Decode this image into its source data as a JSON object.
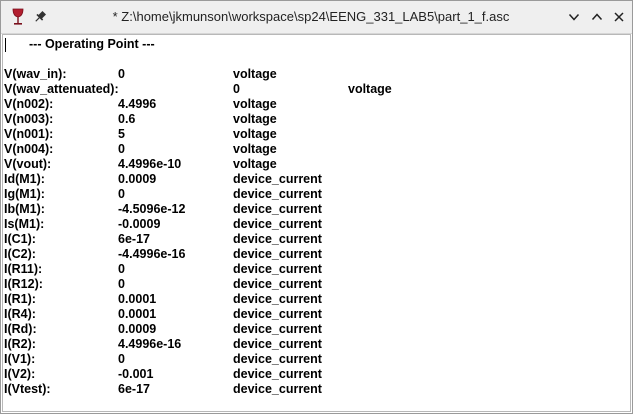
{
  "window": {
    "title": "* Z:\\home\\jkmunson\\workspace\\sp24\\EENG_331_LAB5\\part_1_f.asc",
    "app_icon": "wine-glass-icon",
    "pin_icon": "pin-icon",
    "controls": [
      "chevron-down-icon",
      "chevron-up-icon",
      "close-icon"
    ]
  },
  "document": {
    "header": "--- Operating Point ---",
    "rows": [
      {
        "name": "V(wav_in):",
        "value": "0",
        "type": "voltage"
      },
      {
        "name": "V(wav_attenuated):",
        "value": "0",
        "type": "voltage"
      },
      {
        "name": "V(n002):",
        "value": "4.4996",
        "type": "voltage"
      },
      {
        "name": "V(n003):",
        "value": "0.6",
        "type": "voltage"
      },
      {
        "name": "V(n001):",
        "value": "5",
        "type": "voltage"
      },
      {
        "name": "V(n004):",
        "value": "0",
        "type": "voltage"
      },
      {
        "name": "V(vout):",
        "value": "4.4996e-10",
        "type": "voltage"
      },
      {
        "name": "Id(M1):",
        "value": "0.0009",
        "type": "device_current"
      },
      {
        "name": "Ig(M1):",
        "value": "0",
        "type": "device_current"
      },
      {
        "name": "Ib(M1):",
        "value": "-4.5096e-12",
        "type": "device_current"
      },
      {
        "name": "Is(M1):",
        "value": "-0.0009",
        "type": "device_current"
      },
      {
        "name": "I(C1):",
        "value": "6e-17",
        "type": "device_current"
      },
      {
        "name": "I(C2):",
        "value": "-4.4996e-16",
        "type": "device_current"
      },
      {
        "name": "I(R11):",
        "value": "0",
        "type": "device_current"
      },
      {
        "name": "I(R12):",
        "value": "0",
        "type": "device_current"
      },
      {
        "name": "I(R1):",
        "value": "0.0001",
        "type": "device_current"
      },
      {
        "name": "I(R4):",
        "value": "0.0001",
        "type": "device_current"
      },
      {
        "name": "I(Rd):",
        "value": "0.0009",
        "type": "device_current"
      },
      {
        "name": "I(R2):",
        "value": "4.4996e-16",
        "type": "device_current"
      },
      {
        "name": "I(V1):",
        "value": "0",
        "type": "device_current"
      },
      {
        "name": "I(V2):",
        "value": "-0.001",
        "type": "device_current"
      },
      {
        "name": "I(Vtest):",
        "value": "6e-17",
        "type": "device_current"
      }
    ]
  }
}
